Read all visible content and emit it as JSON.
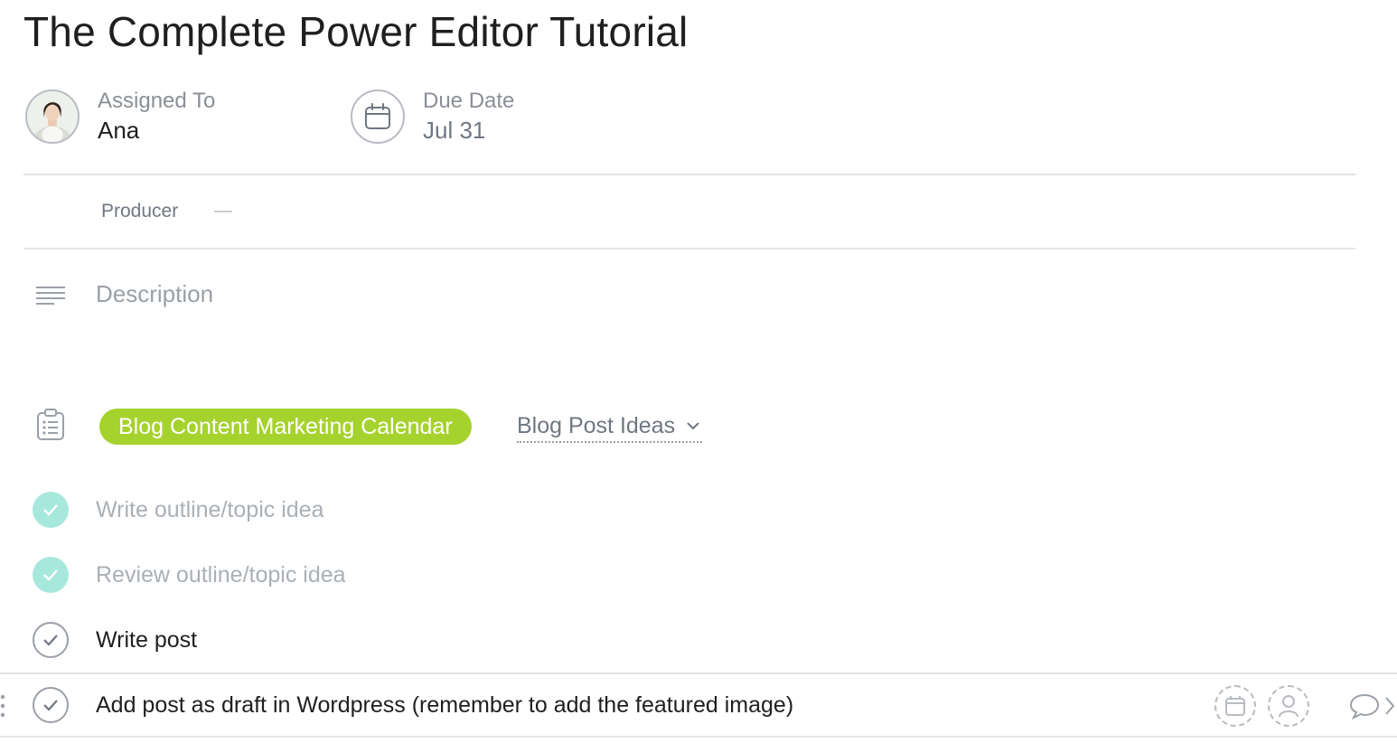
{
  "task": {
    "title": "The Complete Power Editor Tutorial",
    "assignee_label": "Assigned To",
    "assignee_name": "Ana",
    "due_label": "Due Date",
    "due_value": "Jul 31"
  },
  "custom_field": {
    "label": "Producer",
    "value": ""
  },
  "description": {
    "placeholder": "Description"
  },
  "project": {
    "name": "Blog Content Marketing Calendar",
    "color": "#a6d22e",
    "section": "Blog Post Ideas"
  },
  "subtasks": [
    {
      "name": "Write outline/topic idea",
      "completed": true
    },
    {
      "name": "Review outline/topic idea",
      "completed": true
    },
    {
      "name": "Write post",
      "completed": false
    },
    {
      "name": "Add post as draft in Wordpress (remember to add the featured image)",
      "completed": false
    }
  ],
  "icons": {
    "assignee": "avatar",
    "due_date": "calendar-icon",
    "description": "align-left-icon",
    "project": "clipboard-list-icon",
    "subtask_due": "calendar-icon",
    "subtask_assignee": "user-icon",
    "comment": "speech-bubble-icon"
  }
}
